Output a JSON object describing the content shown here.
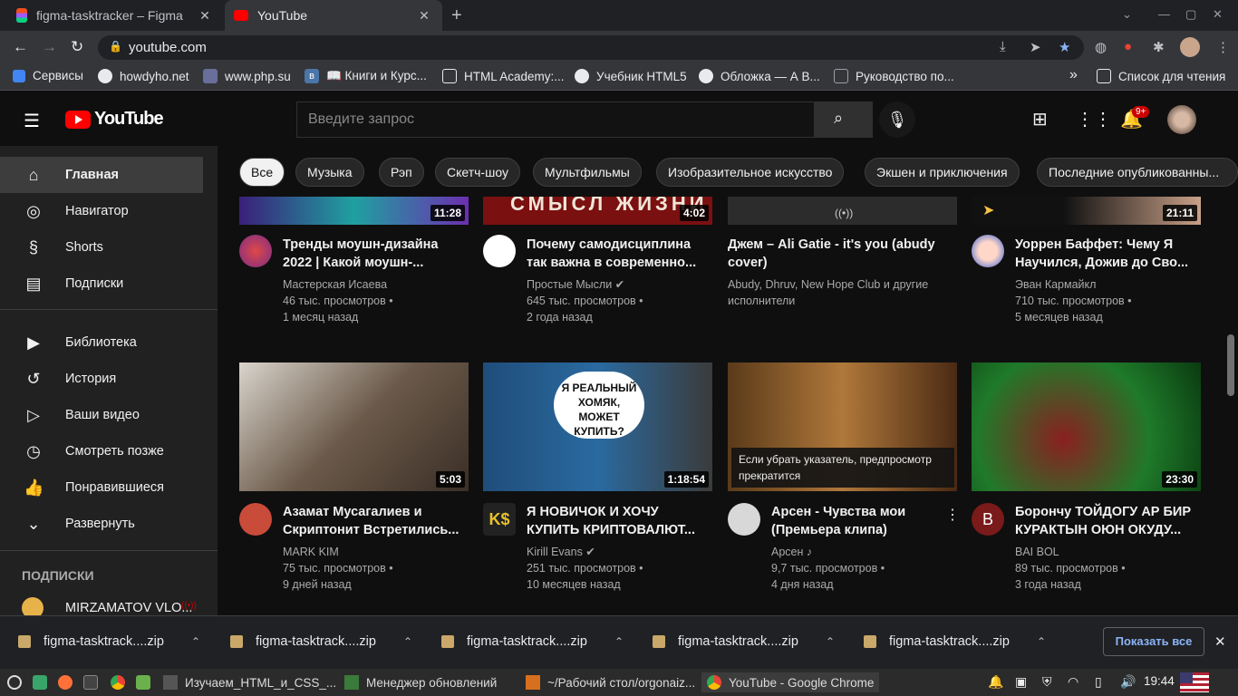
{
  "browser": {
    "tabs": [
      {
        "title": "figma-tasktracker – Figma"
      },
      {
        "title": "YouTube"
      }
    ],
    "new_tab": "+",
    "url": "youtube.com",
    "bookmarks": [
      {
        "label": "Сервисы"
      },
      {
        "label": "howdyho.net"
      },
      {
        "label": "www.php.su"
      },
      {
        "label": "📖 Книги и Курс..."
      },
      {
        "label": "HTML Academy:..."
      },
      {
        "label": "Учебник HTML5"
      },
      {
        "label": "Обложка — А В..."
      },
      {
        "label": "Руководство по..."
      }
    ],
    "reading_list": "Список для чтения",
    "more": "»"
  },
  "youtube": {
    "logo": "YouTube",
    "search_placeholder": "Введите запрос",
    "notifications_badge": "9+",
    "sidebar": {
      "items": [
        {
          "label": "Главная",
          "icon": "home-icon"
        },
        {
          "label": "Навигатор",
          "icon": "compass-icon"
        },
        {
          "label": "Shorts",
          "icon": "shorts-icon"
        },
        {
          "label": "Подписки",
          "icon": "subscriptions-icon"
        },
        {
          "label": "Библиотека",
          "icon": "library-icon"
        },
        {
          "label": "История",
          "icon": "history-icon"
        },
        {
          "label": "Ваши видео",
          "icon": "your-videos-icon"
        },
        {
          "label": "Смотреть позже",
          "icon": "watch-later-icon"
        },
        {
          "label": "Понравившиеся",
          "icon": "like-icon"
        },
        {
          "label": "Развернуть",
          "icon": "chevron-down-icon"
        }
      ],
      "subs_heading": "ПОДПИСКИ",
      "sub_channel": "MIRZAMATOV VLO..."
    },
    "chips": [
      "Все",
      "Музыка",
      "Рэп",
      "Скетч-шоу",
      "Мультфильмы",
      "Изобразительное искусство",
      "Экшен и приключения",
      "Последние опубликованны..."
    ],
    "videos_row1": [
      {
        "duration": "11:28",
        "title1": "Тренды моушн-дизайна",
        "title2": "2022 | Какой моушн-...",
        "channel": "Мастерская Исаева",
        "views": "46 тыс. просмотров •",
        "age": "1 месяц назад",
        "thumb_text": ""
      },
      {
        "duration": "4:02",
        "title1": "Почему самодисциплина",
        "title2": "так важна в современно...",
        "channel": "Простые Мысли ✔",
        "views": "645 тыс. просмотров •",
        "age": "2 года назад",
        "thumb_text": "СМЫСЛ ЖИЗНИ"
      },
      {
        "duration": "",
        "title1": "Джем – Ali Gatie - it's you (abudy",
        "title2": "cover)",
        "channel": "Abudy, Dhruv, New Hope Club и другие",
        "views": "исполнители",
        "age": "",
        "thumb_text": ""
      },
      {
        "duration": "21:11",
        "title1": "Уоррен Баффет: Чему Я",
        "title2": "Научился, Дожив до Сво...",
        "channel": "Эван Кармайкл",
        "views": "710 тыс. просмотров •",
        "age": "5 месяцев назад",
        "thumb_text": ""
      }
    ],
    "videos_row2": [
      {
        "duration": "5:03",
        "title1": "Азамат Мусагалиев и",
        "title2": "Скриптонит Встретились...",
        "channel": "MARK KIM",
        "views": "75 тыс. просмотров •",
        "age": "9 дней назад",
        "thumb_text": ""
      },
      {
        "duration": "1:18:54",
        "title1": "Я НОВИЧОК И ХОЧУ",
        "title2": "КУПИТЬ КРИПТОВАЛЮТ...",
        "channel": "Kirill Evans ✔",
        "views": "251 тыс. просмотров •",
        "age": "10 месяцев назад",
        "thumb_text": "Я РЕАЛЬНЫЙ ХОМЯК, МОЖЕТ КУПИТЬ?"
      },
      {
        "duration": "",
        "title1": "Арсен - Чувства мои",
        "title2": "(Премьера клипа)",
        "channel": "Арсен ♪",
        "views": "9,7 тыс. просмотров •",
        "age": "4 дня назад",
        "thumb_text": "Если убрать указатель, предпросмотр прекратится"
      },
      {
        "duration": "23:30",
        "title1": "Борончу ТОЙДОГУ АР БИР",
        "title2": "КУРАКТЫН ОЮН ОКУДУ...",
        "channel": "BAI BOL",
        "views": "89 тыс. просмотров •",
        "age": "3 года назад",
        "thumb_text": ""
      }
    ]
  },
  "downloads": {
    "items": [
      "figma-tasktrack....zip",
      "figma-tasktrack....zip",
      "figma-tasktrack....zip",
      "figma-tasktrack....zip",
      "figma-tasktrack....zip"
    ],
    "show_all": "Показать все"
  },
  "taskbar": {
    "windows": [
      "Изучаем_HTML_и_CSS_...",
      "Менеджер обновлений",
      "~/Рабочий стол/orgonaiz...",
      "YouTube - Google Chrome"
    ],
    "clock": "19:44"
  }
}
